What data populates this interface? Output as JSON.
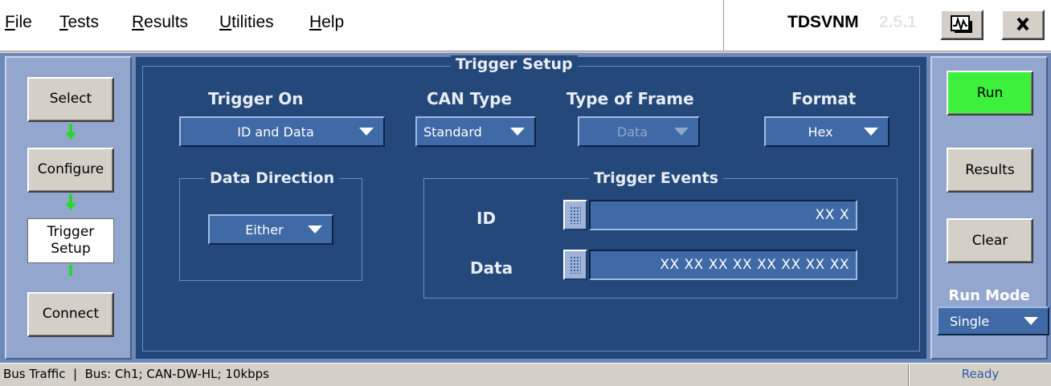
{
  "menu": {
    "file": "File",
    "tests": "Tests",
    "results": "Results",
    "utilities": "Utilities",
    "help": "Help"
  },
  "app": {
    "title": "TDSVNM",
    "version": "2.5.1"
  },
  "nav": {
    "select": "Select",
    "configure": "Configure",
    "trigger_setup_line1": "Trigger",
    "trigger_setup_line2": "Setup",
    "connect": "Connect"
  },
  "trigger_setup": {
    "title": "Trigger Setup",
    "trigger_on": {
      "label": "Trigger On",
      "value": "ID and Data"
    },
    "can_type": {
      "label": "CAN Type",
      "value": "Standard"
    },
    "type_of_frame": {
      "label": "Type of Frame",
      "value": "Data",
      "disabled": true
    },
    "format": {
      "label": "Format",
      "value": "Hex"
    },
    "data_direction": {
      "title": "Data Direction",
      "value": "Either"
    },
    "trigger_events": {
      "title": "Trigger Events",
      "id_label": "ID",
      "id_value": "XX X",
      "data_label": "Data",
      "data_value": "XX XX XX XX XX XX XX XX"
    }
  },
  "side": {
    "run": "Run",
    "results": "Results",
    "clear": "Clear",
    "run_mode_label": "Run Mode",
    "run_mode_value": "Single"
  },
  "status": {
    "left": "Bus Traffic  |  Bus: Ch1; CAN-DW-HL; 10kbps",
    "right": "Ready"
  },
  "colors": {
    "panel_blue": "#24487a",
    "side_blue": "#93a6cd",
    "run_green": "#3cf03c",
    "arrow_green": "#28d828"
  },
  "icons": [
    "scope-icon",
    "close-icon",
    "keypad-icon",
    "dropdown-caret-icon",
    "flow-arrow-icon"
  ]
}
